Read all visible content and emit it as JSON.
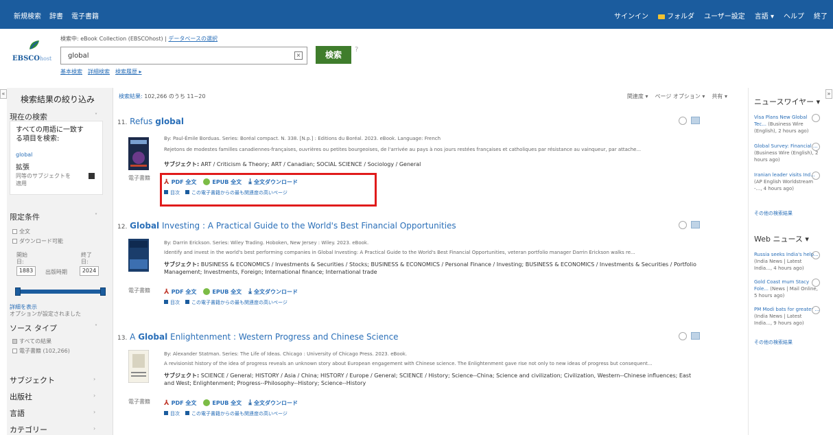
{
  "topbar": {
    "left": [
      "新規検索",
      "辞書",
      "電子書籍"
    ],
    "signin": "サインイン",
    "folder": "フォルダ",
    "prefs": "ユーザー設定",
    "lang": "言語 ▾",
    "help": "ヘルプ",
    "exit": "終了"
  },
  "header": {
    "logo_main": "EBSCO",
    "logo_sub": "host",
    "searching_label": "検索中: eBook Collection (EBSCOhost)",
    "choose_db": "データベースの選択",
    "query": "global",
    "clear": "×",
    "search_button": "検索",
    "help_icon": "?",
    "links": [
      "基本検索",
      "詳細検索",
      "検索履歴 ▸"
    ]
  },
  "left": {
    "title": "検索結果の絞り込み",
    "current_search": "現在の検索",
    "all_words_line1": "すべての用語に一致す",
    "all_words_line2": "る項目を検索:",
    "term": "global",
    "expand": "拡張",
    "equiv_line1": "同等のサブジェクトを",
    "equiv_line2": "適用",
    "limits": "限定条件",
    "fulltext": "全文",
    "downloadable": "ダウンロード可能",
    "start_label": "開始",
    "start_sub": "日:",
    "end_label": "終了",
    "end_sub": "日:",
    "year_from": "1883",
    "pub_date": "出版時期",
    "year_to": "2024",
    "show_more": "詳細を表示",
    "options_set": "オプションが設定されました",
    "source_type": "ソース タイプ",
    "all_results": "すべての結果",
    "ebooks": "電子書籍 (102,266)",
    "subject": "サブジェクト",
    "publisher": "出版社",
    "language": "言語",
    "category": "カテゴリー"
  },
  "results": {
    "count_label": "検索結果:",
    "count_text": "102,266 のうち 11~20",
    "opts": [
      "関連度 ▾",
      "ページ オプション ▾",
      "共有 ▾"
    ],
    "pdf": "PDF 全文",
    "epub": "EPUB 全文",
    "download": "全文ダウンロード",
    "toc": "目次",
    "most_relevant": "この電子書籍からの最も関連度の高いページ",
    "ebook_type": "電子書籍",
    "subject_label": "サブジェクト:",
    "items": [
      {
        "num": "11.",
        "t_pre": "Refus ",
        "t_bold": "global",
        "t_post": "",
        "meta": "By: Paul-Émile Borduas. Series: Boréal compact. N. 338. [N.p.] : Editions du Boréal. 2023. eBook. Language: French",
        "desc": "Rejetons de modestes familles canadiennes-françaises, ouvrières ou petites bourgeoises, de l'arrivée au pays à nos jours restées françaises et catholiques par résistance au vainqueur, par attache...",
        "subjects": "ART / Criticism & Theory; ART / Canadian; SOCIAL SCIENCE / Sociology / General"
      },
      {
        "num": "12.",
        "t_pre": "",
        "t_bold": "Global",
        "t_post": " Investing : A Practical Guide to the World's Best Financial Opportunities",
        "meta": "By: Darrin Erickson. Series: Wiley Trading. Hoboken, New Jersey : Wiley. 2023. eBook.",
        "desc": "Identify and invest in the world's best performing companies in Global Investing: A Practical Guide to the World's Best Financial Opportunities, veteran portfolio manager Darrin Erickson walks re...",
        "subjects": "BUSINESS & ECONOMICS / Investments & Securities / Stocks; BUSINESS & ECONOMICS / Personal Finance / Investing; BUSINESS & ECONOMICS / Investments & Securities / Portfolio Management; Investments, Foreign; International finance; International trade"
      },
      {
        "num": "13.",
        "t_pre": "A ",
        "t_bold": "Global",
        "t_post": " Enlightenment : Western Progress and Chinese Science",
        "meta": "By: Alexander Statman. Series: The Life of Ideas. Chicago : University of Chicago Press. 2023. eBook.",
        "desc": "A revisionist history of the idea of progress reveals an unknown story about European engagement with Chinese science. The Enlightenment gave rise not only to new ideas of progress but consequent...",
        "subjects": "SCIENCE / General; HISTORY / Asia / China; HISTORY / Europe / General; SCIENCE / History; Science--China; Science and civilization; Civilization, Western--Chinese influences; East and West; Enlightenment; Progress--Philosophy--History; Science--History"
      }
    ]
  },
  "right": {
    "newswire": "ニュースワイヤー ▾",
    "news1_title": "Visa Plans New Global Tec...",
    "news1_src": "(Business Wire (English), 2 hours ago)",
    "news2_title": "Global Survey: Financial ...",
    "news2_src": "(Business Wire (English), 2 hours ago)",
    "news3_title": "Iranian leader visits Ind...",
    "news3_src": "(AP English Worldstream -..., 4 hours ago)",
    "more1": "その他の検索結果",
    "web_news": "Web ニュース ▾",
    "web1_title": "Russia seeks India's help...",
    "web1_src": "(India News | Latest India..., 4 hours ago)",
    "web2_title": "Gold Coast mum Stacy Fole...",
    "web2_src": "(News | Mail Online, 5 hours ago)",
    "web3_title": "PM Modi bats for greater ...",
    "web3_src": "(India News | Latest India..., 9 hours ago)",
    "more2": "その他の検索結果"
  },
  "colors": {
    "topbar": "#1b5c9e",
    "search_button": "#3f7d2c",
    "highlight_box": "#e01b1b",
    "link": "#2a6fb8"
  }
}
